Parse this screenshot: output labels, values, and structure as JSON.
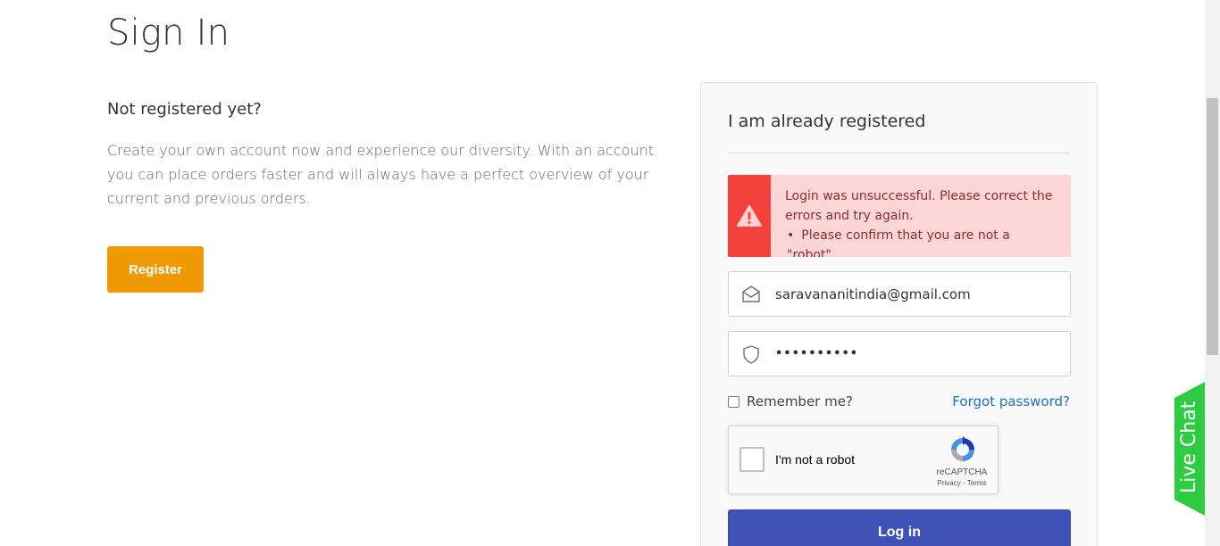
{
  "page": {
    "title": "Sign In"
  },
  "new_customer": {
    "heading": "Not registered yet?",
    "description": "Create your own account now and experience our diversity. With an account you can place orders faster and will always have a perfect overview of your current and previous orders.",
    "register_label": "Register"
  },
  "login": {
    "heading": "I am already registered",
    "alert": {
      "message": "Login was unsuccessful. Please correct the errors and try again.",
      "errors": [
        "Please confirm that you are not a \"robot\"."
      ],
      "icon": "warning-icon",
      "color": "#f3403a",
      "background": "#fcd6d6"
    },
    "email": {
      "value": "saravananitindia@gmail.com",
      "icon": "envelope-icon"
    },
    "password": {
      "value": "••••••••••",
      "icon": "shield-icon"
    },
    "remember_label": "Remember me?",
    "forgot_label": "Forgot password?",
    "recaptcha": {
      "label": "I'm not a robot",
      "brand": "reCAPTCHA",
      "privacy": "Privacy",
      "separator": " - ",
      "terms": "Terms"
    },
    "login_label": "Log in"
  },
  "live_chat": {
    "label": "Live Chat",
    "color": "#2ecc40"
  },
  "colors": {
    "register_button": "#ef9a05",
    "login_button": "#3f51b5",
    "link": "#1a73b8"
  }
}
